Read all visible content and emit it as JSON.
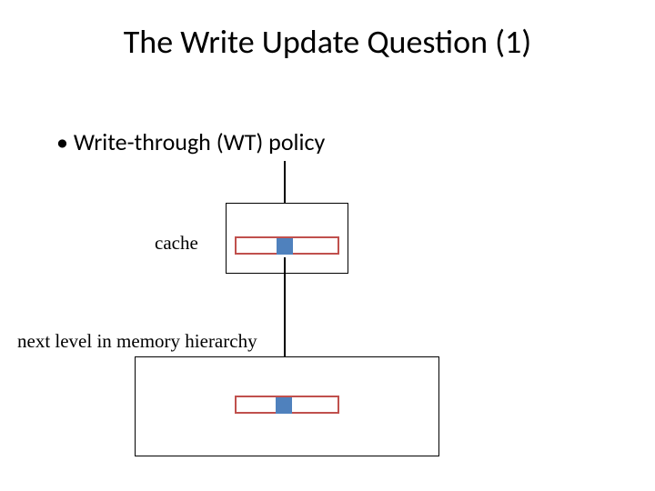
{
  "title": "The Write Update Question (1)",
  "bullet": "Write-through (WT) policy",
  "labels": {
    "cache": "cache",
    "memory": "next level in memory hierarchy"
  }
}
